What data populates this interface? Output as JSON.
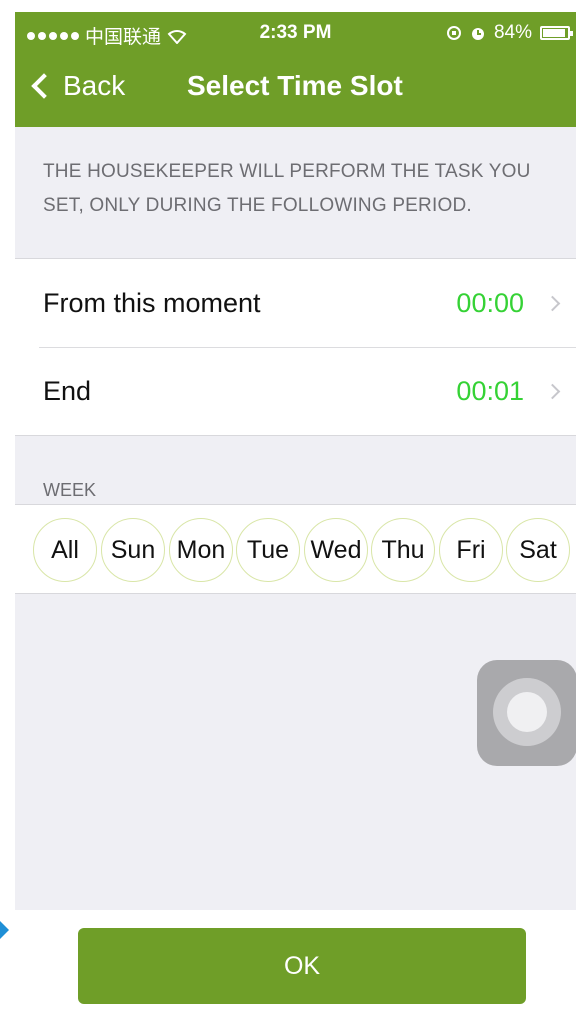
{
  "status_bar": {
    "carrier": "中国联通",
    "time": "2:33 PM",
    "battery": "84%",
    "battery_level": 0.84
  },
  "nav": {
    "back_label": "Back",
    "title": "Select Time Slot"
  },
  "description": "THE HOUSEKEEPER WILL PERFORM THE TASK YOU SET, ONLY DURING THE FOLLOWING PERIOD.",
  "time_rows": [
    {
      "label": "From this moment",
      "value": "00:00"
    },
    {
      "label": "End",
      "value": "00:01"
    }
  ],
  "week": {
    "label": "WEEK",
    "days": [
      "All",
      "Sun",
      "Mon",
      "Tue",
      "Wed",
      "Thu",
      "Fri",
      "Sat"
    ]
  },
  "ok_label": "OK",
  "colors": {
    "accent": "#6f9e28",
    "value_green": "#35d235",
    "background": "#efeff4"
  }
}
